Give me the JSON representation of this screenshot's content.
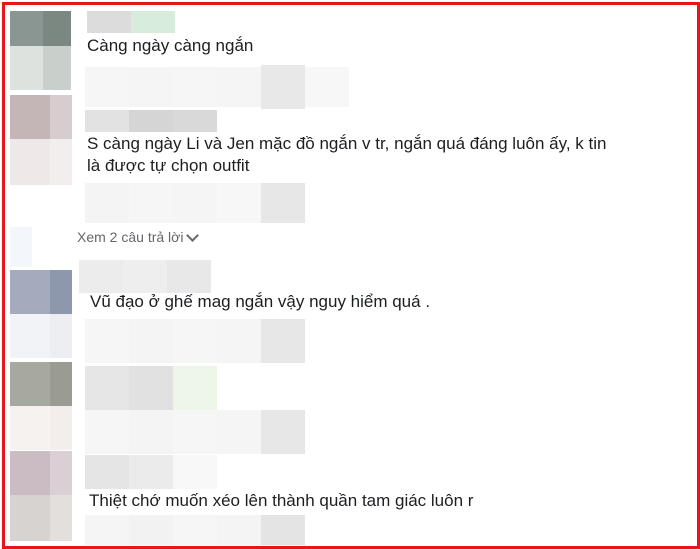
{
  "comments": [
    {
      "text": "Càng ngày càng ngắn"
    },
    {
      "text": "S càng ngày Li và Jen mặc đồ ngắn v tr, ngắn quá đáng luôn ấy, k tin",
      "text_line2": "là được tự chọn outfit"
    },
    {
      "text": "Vũ đạo ở ghế mag ngắn vậy nguy hiểm quá ."
    },
    {
      "text": "Thiệt chớ muốn xéo lên thành quần tam giác luôn r"
    }
  ],
  "reply_link": {
    "label": "Xem 2 câu trả lời",
    "icon": "chevron-down-icon"
  },
  "colors": {
    "border": "#e8161b",
    "text": "#1c1e21",
    "muted": "#65676b"
  }
}
